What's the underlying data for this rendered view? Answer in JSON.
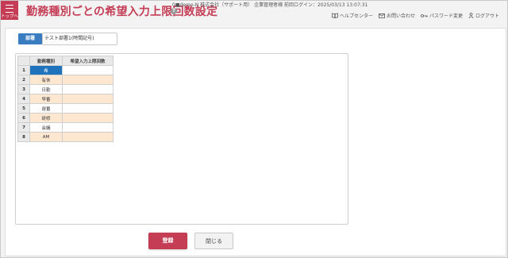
{
  "header": {
    "menu_label": "トップへ",
    "title": "勤務種別ごとの希望入力上限回数設定",
    "account_info": "0■demo-N 株式会社（サポート用） 企業管理者様 前回ログイン：2025/03/13 13:07:31",
    "help_symbol": "?",
    "links": [
      {
        "icon": "book-icon",
        "label": "ヘルプセンター"
      },
      {
        "icon": "mail-icon",
        "label": "お問い合わせ"
      },
      {
        "icon": "key-icon",
        "label": "パスワード変更"
      },
      {
        "icon": "person-icon",
        "label": "ログアウト"
      }
    ]
  },
  "department": {
    "tag": "部署",
    "value": "テスト部署1(時間記号)"
  },
  "table": {
    "headers": [
      "勤務種別",
      "希望入力上限回数"
    ],
    "rows": [
      {
        "no": "1",
        "type": "希",
        "limit": "",
        "selected": true
      },
      {
        "no": "2",
        "type": "有休",
        "limit": ""
      },
      {
        "no": "3",
        "type": "日勤",
        "limit": ""
      },
      {
        "no": "4",
        "type": "早番",
        "limit": ""
      },
      {
        "no": "5",
        "type": "遅番",
        "limit": ""
      },
      {
        "no": "6",
        "type": "研修",
        "limit": ""
      },
      {
        "no": "7",
        "type": "会議",
        "limit": ""
      },
      {
        "no": "8",
        "type": "AM",
        "limit": ""
      }
    ]
  },
  "buttons": {
    "register": "登録",
    "close": "閉じる"
  },
  "colors": {
    "brand": "#c43d55",
    "dept_tag": "#3a7cc0",
    "selected_cell": "#1f73bd",
    "alt_row": "#fde7d1"
  }
}
